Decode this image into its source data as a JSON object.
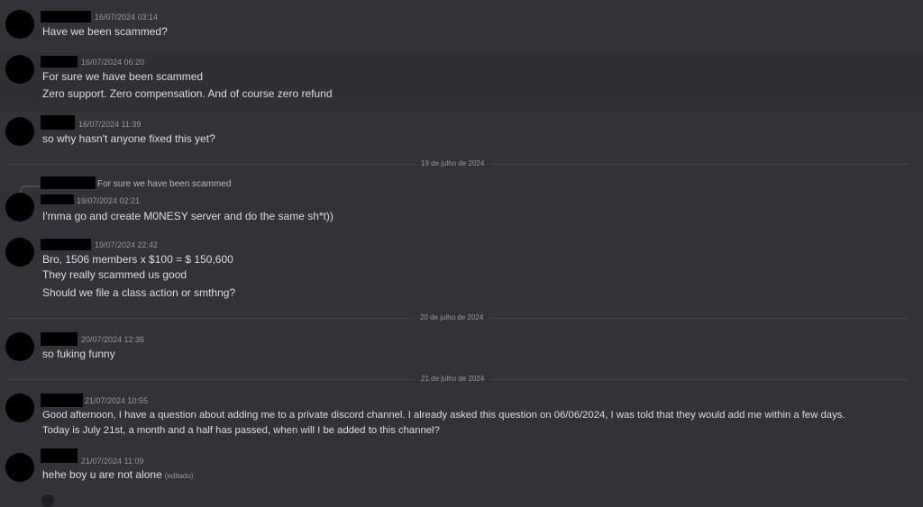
{
  "messages": [
    {
      "ts": "16/07/2024 03:14",
      "lines": [
        "Have we been scammed?"
      ]
    },
    {
      "ts": "16/07/2024 06:20",
      "lines": [
        "For sure we have been scammed",
        "Zero support. Zero compensation. And of course zero refund"
      ]
    },
    {
      "ts": "16/07/2024 11:39",
      "lines": [
        "so why hasn't anyone fixed this yet?"
      ]
    },
    {
      "ts": "19/07/2024 02:21",
      "reply_preview": "For sure we have been scammed",
      "lines": [
        "I'mma go and create M0NESY server and do the same sh*t))"
      ]
    },
    {
      "ts": "19/07/2024 22:42",
      "lines": [
        "Bro, 1506 members x $100 = $ 150,600",
        "They really scammed us good",
        "Should we file a class action or smthng?"
      ]
    },
    {
      "ts": "20/07/2024 12:36",
      "lines": [
        "so fuking funny"
      ]
    },
    {
      "ts": "21/07/2024 10:55",
      "lines": [
        "Good afternoon, I have a question about adding me to a private discord channel. I already asked this question on 06/06/2024, I was told that they would add me within a few days.",
        "Today is July 21st, a month and a half has passed, when will I be added to this channel?"
      ]
    },
    {
      "ts": "21/07/2024 11:09",
      "lines": [
        "hehe boy u are not alone"
      ],
      "edited": "(editado)"
    }
  ],
  "dividers": [
    "19 de julho de 2024",
    "20 de julho de 2024",
    "21 de julho de 2024"
  ]
}
